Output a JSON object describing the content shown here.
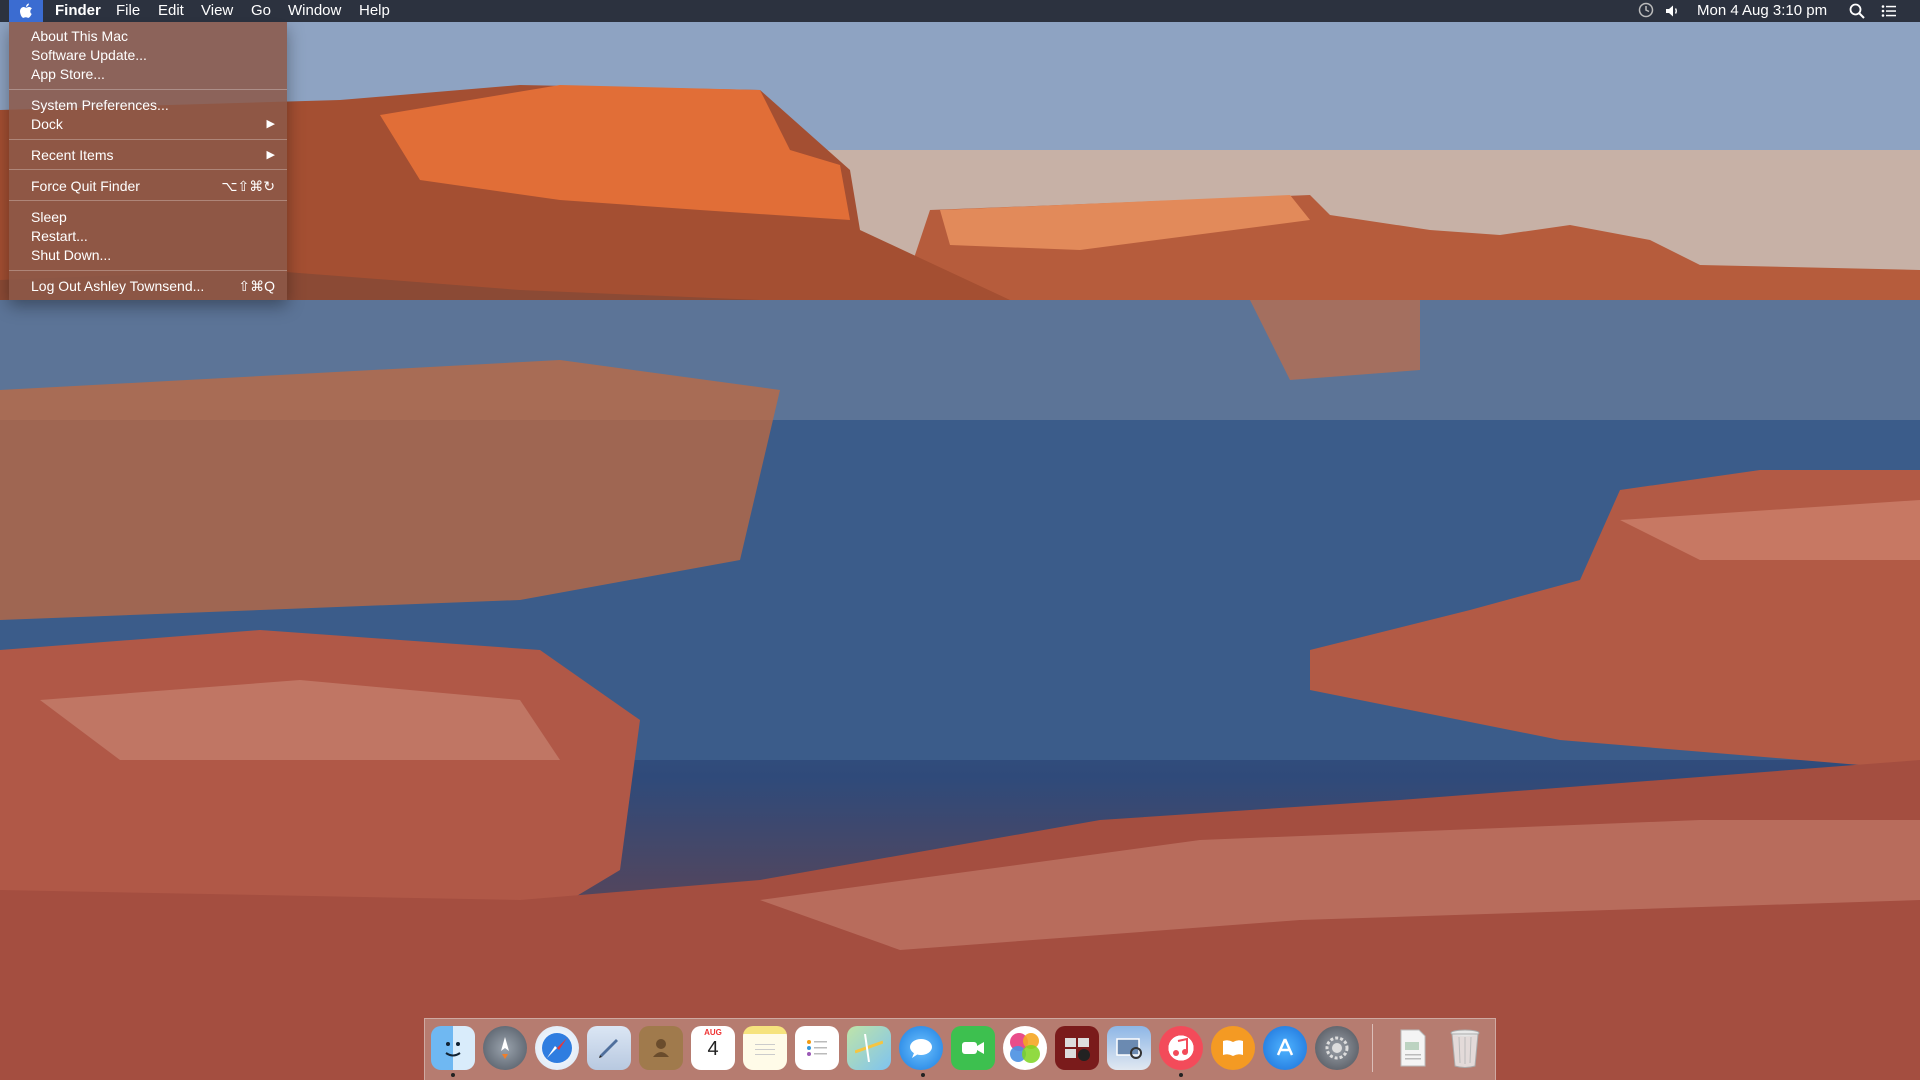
{
  "menubar": {
    "apple_glyph": "",
    "app_name": "Finder",
    "menus": [
      "File",
      "Edit",
      "View",
      "Go",
      "Window",
      "Help"
    ],
    "clock": "Mon 4 Aug  3:10 pm"
  },
  "apple_menu": {
    "items": [
      {
        "label": "About This Mac"
      },
      {
        "label": "Software Update..."
      },
      {
        "label": "App Store..."
      },
      {
        "label": "System Preferences..."
      },
      {
        "label": "Dock",
        "submenu_glyph": "▶"
      },
      {
        "label": "Recent Items",
        "submenu_glyph": "▶"
      },
      {
        "label": "Force Quit Finder",
        "shortcut": "⌥⇧⌘↻"
      },
      {
        "label": "Sleep"
      },
      {
        "label": "Restart..."
      },
      {
        "label": "Shut Down..."
      },
      {
        "label": "Log Out Ashley Townsend...",
        "shortcut": "⇧⌘Q"
      }
    ]
  },
  "dock": {
    "calendar": {
      "month": "AUG",
      "day": "4"
    },
    "icons": [
      "finder-icon",
      "launchpad-icon",
      "safari-icon",
      "mail-icon",
      "contacts-icon",
      "calendar-icon",
      "notes-icon",
      "reminders-icon",
      "maps-icon",
      "messages-icon",
      "facetime-icon",
      "game-center-icon",
      "photo-booth-icon",
      "preview-icon",
      "itunes-icon",
      "ibooks-icon",
      "app-store-icon",
      "system-preferences-icon",
      "documents-icon",
      "trash-icon"
    ]
  },
  "colors": {
    "menu_highlight": "#3b6cd1",
    "menubar_bg": "#212631"
  }
}
